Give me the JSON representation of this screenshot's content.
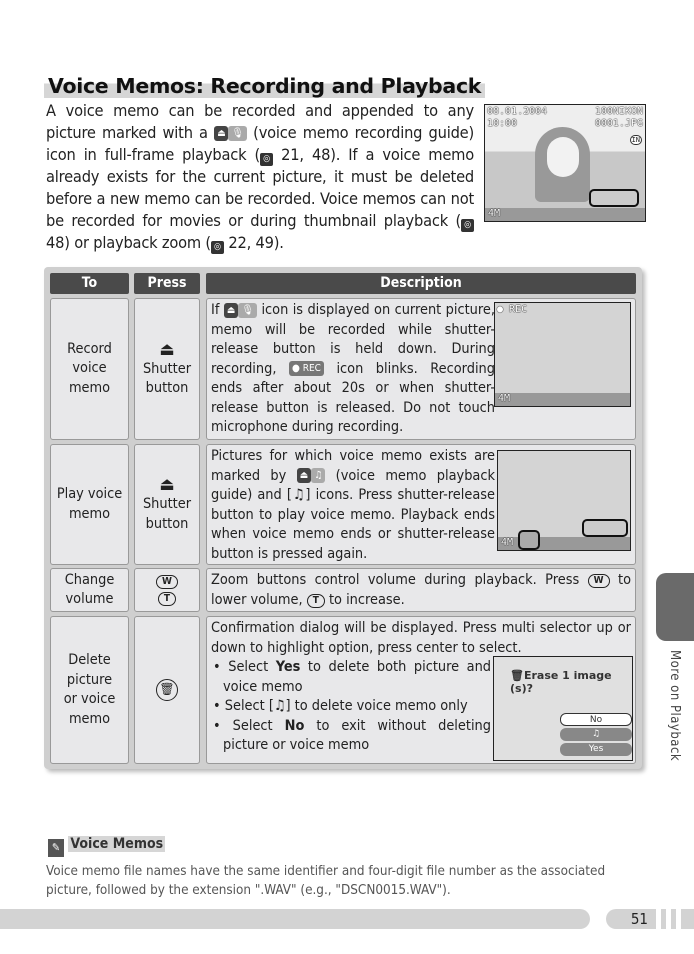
{
  "title": "Voice Memos: Recording and Playback",
  "intro": {
    "p1": "A voice memo can be recorded and appended to any picture marked with a",
    "p2": "(voice memo recording guide) icon in full-frame playback (",
    "r1": "21, 48).  If a voice memo already exists for the current picture, it must be deleted before a new memo can be recorded.  Voice memos can not be recorded for movies or during thumbnail playback (",
    "r2": "48) or playback zoom (",
    "r3": "22, 49)."
  },
  "screen1": {
    "date": "08.01.2004",
    "time": "10:00",
    "folder": "100NIKON",
    "file": "0001.JPG",
    "mem": "IN",
    "size": "4M"
  },
  "table": {
    "headers": [
      "To",
      "Press",
      "Description"
    ],
    "rows": [
      {
        "to": "Record voice memo",
        "press": "Shutter button",
        "d1": "If",
        "d2": "icon is displayed on current picture, memo will be recorded while shutter-release button is held down. During recording,",
        "d3": "icon blinks.  Recording ends after about 20s or when shutter-release button is released.  Do not touch microphone during recording.",
        "rec": "REC",
        "size": "4M"
      },
      {
        "to": "Play voice memo",
        "press": "Shutter button",
        "d1": "Pictures for which voice memo exists are marked by",
        "d2": "(voice memo playback guide) and",
        "d3": "icons.  Press shutter-release button to play voice memo. Playback ends when voice memo ends or shutter-release button is pressed again.",
        "size": "4M"
      },
      {
        "to": "Change volume",
        "press_w": "W",
        "press_t": "T",
        "d1": "Zoom buttons control volume during playback.  Press",
        "d2": "to lower volume,",
        "d3": "to increase."
      },
      {
        "to": "Delete picture or voice memo",
        "d0": "Confirmation dialog will be displayed.  Press multi selector up or down to highlight option, press center to select.",
        "b1a": "Select",
        "b1b": "Yes",
        "b1c": "to delete both picture and voice memo",
        "b2a": "Select",
        "b2c": "to delete voice memo only",
        "b3a": "Select",
        "b3b": "No",
        "b3c": "to exit without deleting picture or voice memo",
        "dialog": {
          "prompt": "Erase 1 image (s)?",
          "options": [
            "No",
            "♫",
            "Yes"
          ]
        }
      }
    ]
  },
  "side_tab": "More on Playback",
  "note": {
    "heading": "Voice Memos",
    "text": "Voice memo file names have the same identifier and four-digit file number as the associated picture, followed by the extension \".WAV\" (e.g., \"DSCN0015.WAV\")."
  },
  "page_number": "51"
}
